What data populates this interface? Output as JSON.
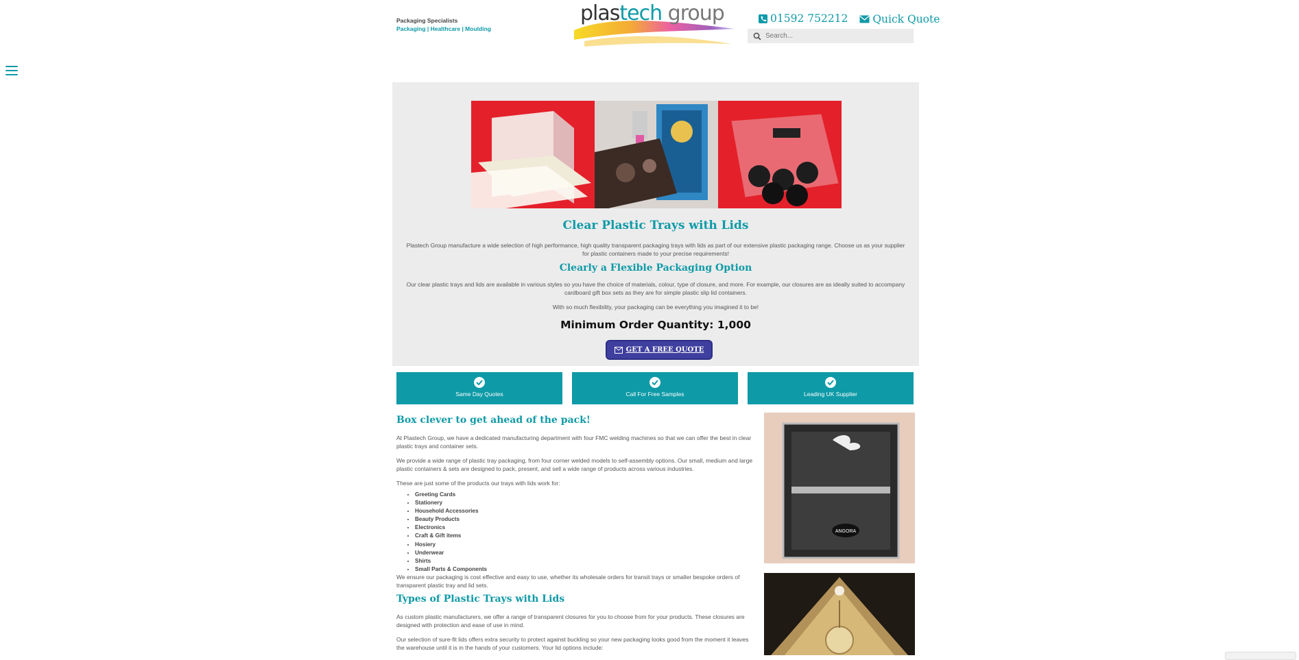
{
  "header": {
    "tagline_title": "Packaging Specialists",
    "tagline_links": "Packaging | Healthcare | Moulding",
    "logo_text_1": "plas",
    "logo_text_2": "tech",
    "logo_text_3": " group",
    "phone": "01592 752212",
    "quick_quote": "Quick Quote",
    "search_placeholder": "Search..."
  },
  "hero": {
    "title": "Clear Plastic Trays with Lids",
    "intro": "Plastech Group manufacture a wide selection of high performance, high quality transparent packaging trays with lids as part of our extensive plastic packaging range. Choose us as your supplier for plastic containers made to your precise requirements!",
    "subtitle": "Clearly a Flexible Packaging Option",
    "para2": "Our clear plastic trays and lids are available in various styles so you have the choice of materials, colour, type of closure, and more. For example, our closures are as ideally suited to accompany cardboard gift box sets as they are for simple plastic slip lid containers.",
    "para3": "With so much flexibility, your packaging can be everything you imagined it to be!",
    "moq": "Minimum Order Quantity: 1,000",
    "cta": "GET A FREE QUOTE"
  },
  "features": [
    {
      "label": "Same Day Quotes"
    },
    {
      "label": "Call For Free Samples"
    },
    {
      "label": "Leading UK Supplier"
    }
  ],
  "content": {
    "heading1": "Box clever to get ahead of the pack!",
    "p1": "At Plastech Group, we have a dedicated manufacturing department with four FMC welding machines so that we can offer the best in clear plastic trays and container sets.",
    "p2": "We provide a wide range of plastic tray packaging, from four corner welded models to self-assembly options. Our small, medium and large plastic containers & sets are designed to pack, present, and sell a wide range of products across various industries.",
    "p3": "These are just some of the products our trays with lids work for:",
    "products": [
      "Greeting Cards",
      "Stationery",
      "Household Accessories",
      "Beauty Products",
      "Electronics",
      "Craft & Gift items",
      "Hosiery",
      "Underwear",
      "Shirts",
      "Small Parts & Components"
    ],
    "p4": "We ensure our packaging is cost effective and easy to use, whether its wholesale orders for transit trays or smaller bespoke orders of transparent plastic tray and lid sets.",
    "heading2": "Types of Plastic Trays with Lids",
    "p5": "As custom plastic manufacturers, we offer a range of transparent closures for you to choose from for your products. These closures are designed with protection and ease of use in mind.",
    "p6": "Our selection of sure-fit lids offers extra security to protect against buckling so your new packaging looks good from the moment it leaves the warehouse until it is in the hands of your customers. Your lid options include:",
    "side_label": "ANGORA"
  },
  "colors": {
    "teal": "#0e9aa7",
    "button": "#3f3f9f",
    "panel": "#ececec"
  }
}
